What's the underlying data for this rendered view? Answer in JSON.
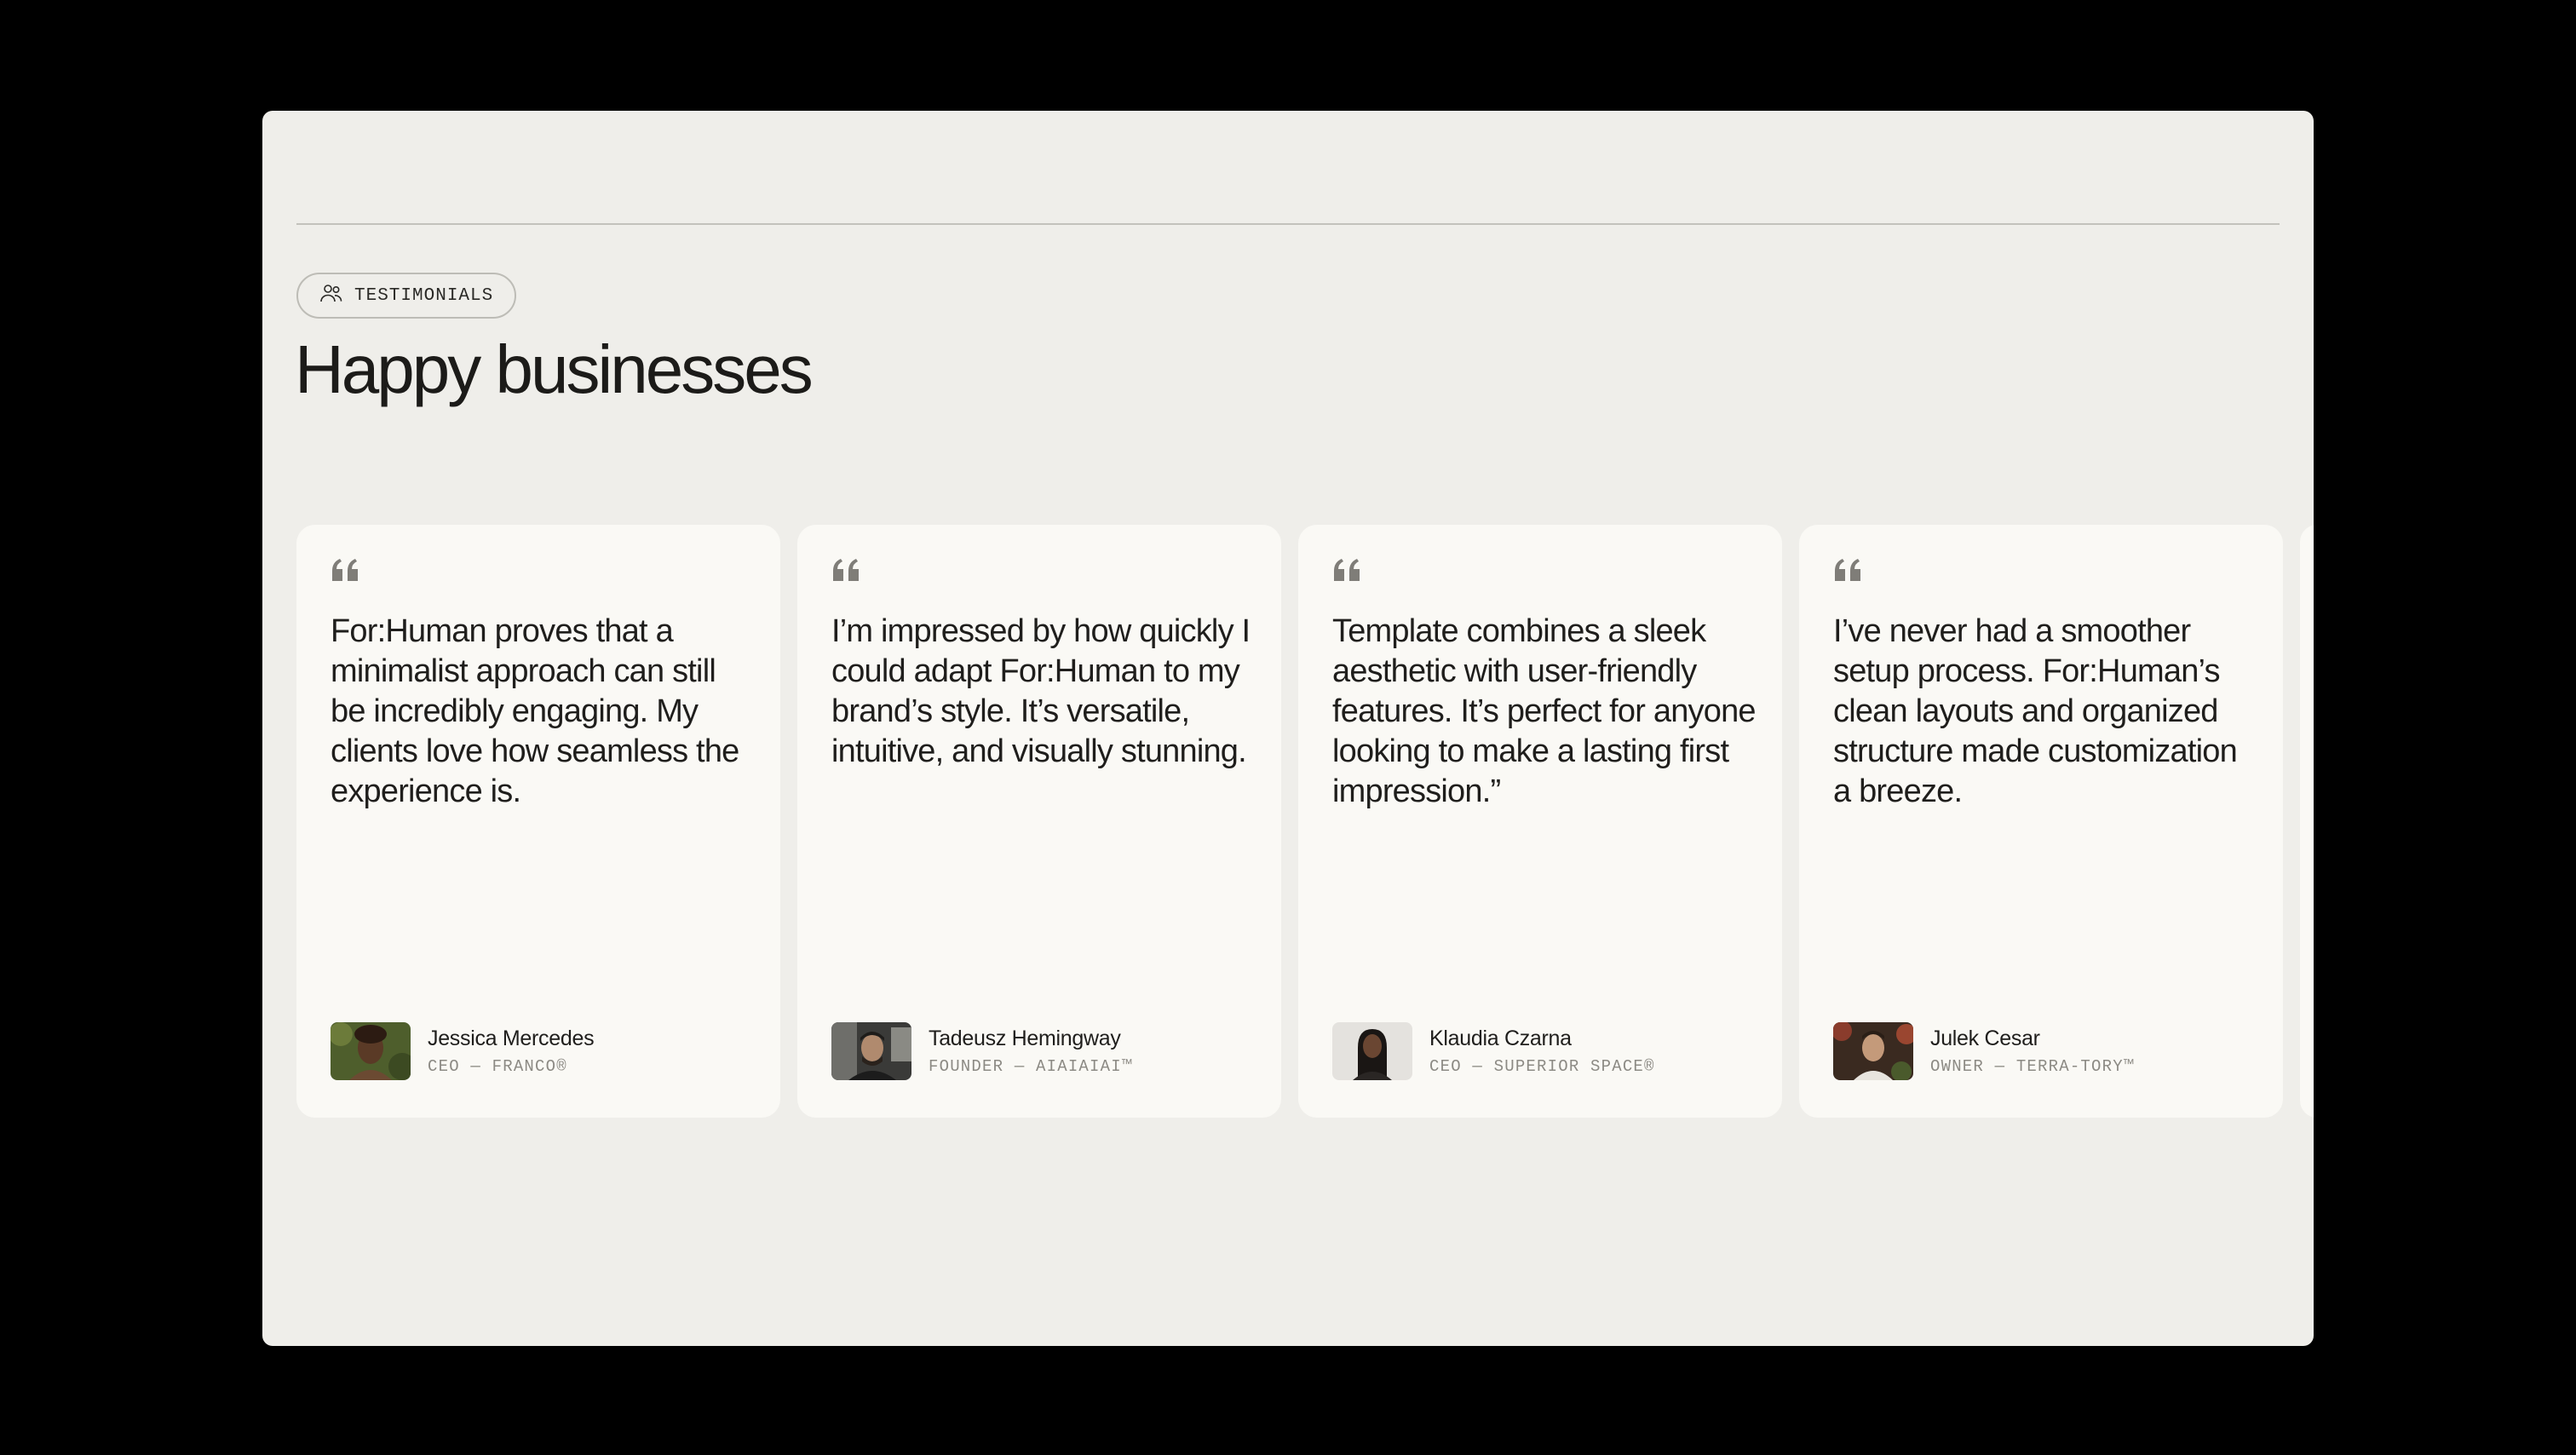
{
  "section": {
    "badge_label": "TESTIMONIALS",
    "badge_icon": "users-icon",
    "title": "Happy businesses"
  },
  "testimonials": [
    {
      "quote": "For:Human proves that a minimalist approach can still be incredibly engaging. My clients love how seamless the experience is.",
      "name": "Jessica Mercedes",
      "role": "CEO — FRANCO®"
    },
    {
      "quote": "I’m impressed by how quickly I could adapt For:Human to my brand’s style. It’s versatile, intuitive, and visually stunning.",
      "name": "Tadeusz Hemingway",
      "role": "FOUNDER — AIAIAIAI™"
    },
    {
      "quote": "Template combines a sleek aesthetic with user-friendly features. It’s perfect for anyone looking to make a lasting first impression.”",
      "name": "Klaudia Czarna",
      "role": "CEO — SUPERIOR SPACE®"
    },
    {
      "quote": "I’ve never had a smoother setup process. For:Human’s clean layouts and organized structure made customization a breeze.",
      "name": "Julek Cesar",
      "role": "OWNER — TERRA-TORY™"
    }
  ],
  "colors": {
    "page_bg": "#000000",
    "panel_bg": "#efeeea",
    "card_bg": "#faf9f5",
    "text": "#1f1e1c",
    "muted": "#8c8a84",
    "quote_mark": "#7f7d78"
  }
}
